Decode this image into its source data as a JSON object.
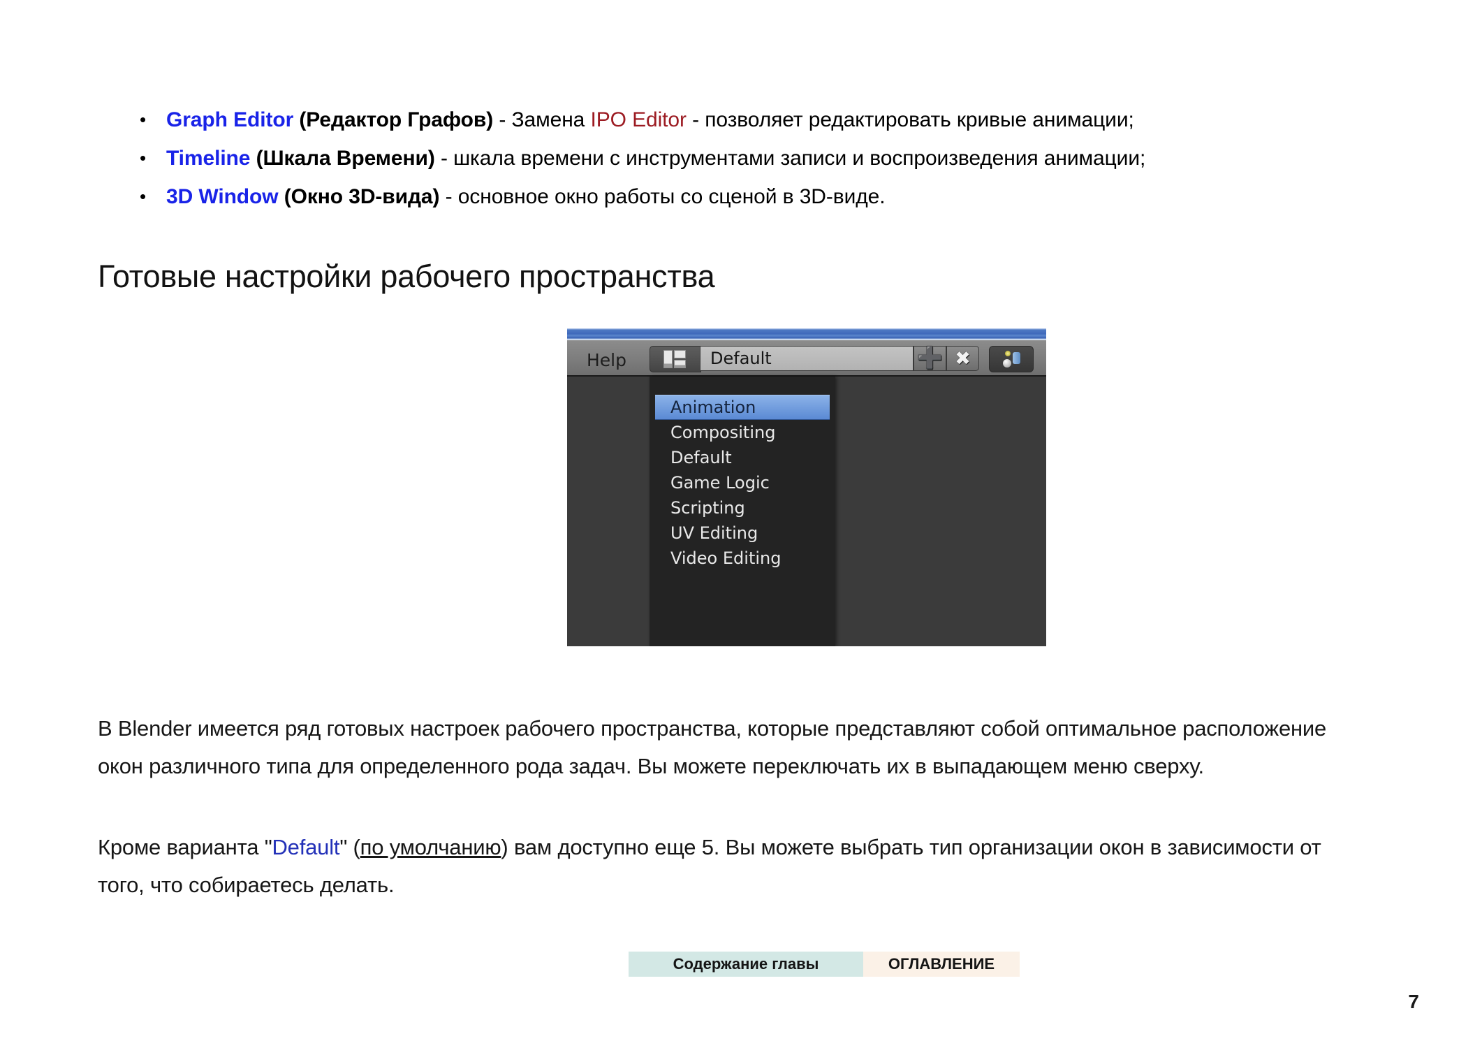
{
  "bullets": [
    {
      "term_en": "Graph Editor",
      "term_ru": " (Редактор Графов)",
      "desc_before": " - Замена ",
      "highlight": "IPO Editor",
      "desc_after": " - позволяет редактировать кривые анимации;"
    },
    {
      "term_en": "Timeline",
      "term_ru": " (Шкала Времени)",
      "desc_before": " - шкала времени с инструментами записи и воспроизведения анимации;",
      "highlight": "",
      "desc_after": ""
    },
    {
      "term_en": "3D Window",
      "term_ru": " (Окно 3D-вида)",
      "desc_before": " - основное окно работы со сценой в 3D-виде.",
      "highlight": "",
      "desc_after": ""
    }
  ],
  "heading": "Готовые настройки рабочего пространства",
  "blender": {
    "help_label": "Help",
    "layout_icon": "window-layout-icon",
    "current_layout": "Default",
    "add_icon": "plus-icon",
    "delete_icon": "cross-icon",
    "scene_icon": "scene-icon",
    "menu_items": [
      "Animation",
      "Compositing",
      "Default",
      "Game Logic",
      "Scripting",
      "UV Editing",
      "Video Editing"
    ],
    "selected_index": 0,
    "accent_selected": "#5b8ad4",
    "menu_bg": "#232323",
    "titlebar_color": "#3f69bb"
  },
  "paragraph_1": {
    "text": "В Blender имеется ряд готовых настроек рабочего пространства, которые представляют собой оптимальное расположение окон различного типа для определенного рода задач. Вы можете переключать их в выпадающем меню сверху."
  },
  "paragraph_2": {
    "before": "Кроме варианта \"",
    "link": "Default",
    "middle": "\" (",
    "underlined": "по умолчанию",
    "after": ") вам доступно еще 5. Вы можете выбрать тип организации окон в зависимости от того, что собираетесь делать."
  },
  "footer": {
    "chapter_contents_label": "Содержание главы",
    "toc_label": "ОГЛАВЛЕНИЕ",
    "chapter_color": "#D3E8E5",
    "toc_color": "#FBF1E7"
  },
  "page_number": "7"
}
